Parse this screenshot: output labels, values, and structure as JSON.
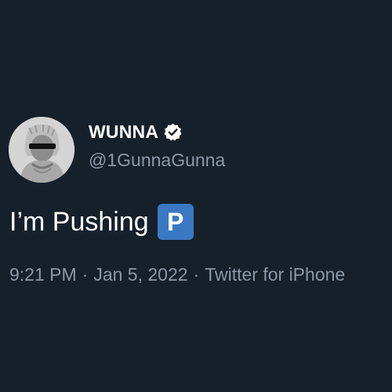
{
  "author": {
    "display_name": "WUNNA",
    "handle": "@1GunnaGunna",
    "verified_icon": "verified-badge-icon",
    "avatar_icon": "profile-avatar"
  },
  "tweet": {
    "text": "I’m Pushing",
    "emoji": "P",
    "emoji_icon": "parking-sign-emoji-icon"
  },
  "meta": {
    "time": "9:21 PM",
    "date": "Jan 5, 2022",
    "source": "Twitter for iPhone",
    "separator": "·"
  },
  "colors": {
    "background": "#15202b",
    "text_primary": "#ffffff",
    "text_secondary": "#8b98a5",
    "emoji_blue": "#3a78c3"
  }
}
